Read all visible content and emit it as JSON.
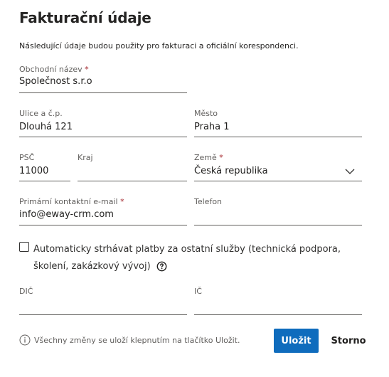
{
  "header": {
    "title": "Fakturační údaje",
    "description": "Následující údaje budou použity pro fakturaci a oficiální korespondenci."
  },
  "fields": {
    "company": {
      "label": "Obchodní název",
      "required": "*",
      "value": "Společnost s.r.o"
    },
    "street": {
      "label": "Ulice a č.p.",
      "value": "Dlouhá 121"
    },
    "city": {
      "label": "Město",
      "value": "Praha 1"
    },
    "zip": {
      "label": "PSČ",
      "value": "11000"
    },
    "region": {
      "label": "Kraj",
      "value": ""
    },
    "country": {
      "label": "Země",
      "required": "*",
      "value": "Česká republika",
      "icon": "chevron-down-icon"
    },
    "email": {
      "label": "Primární kontaktní e-mail",
      "required": "*",
      "value": "info@eway-crm.com"
    },
    "phone": {
      "label": "Telefon",
      "value": ""
    },
    "vat": {
      "label": "DIČ",
      "value": ""
    },
    "ico": {
      "label": "IČ",
      "value": ""
    }
  },
  "autopay": {
    "label": "Automaticky strhávat platby za ostatní služby (technická podpora, školení, zakázkový vývoj)",
    "checked": false,
    "icon": "question-circle-icon"
  },
  "footer": {
    "note": "Všechny změny se uloží klepnutím na tlačítko Uložit.",
    "note_icon": "info-circle-icon",
    "save_label": "Uložit",
    "cancel_label": "Storno"
  },
  "colors": {
    "primary": "#0f6cbd",
    "required": "#a4262c",
    "label": "#605e5c",
    "text": "#201f1e"
  }
}
